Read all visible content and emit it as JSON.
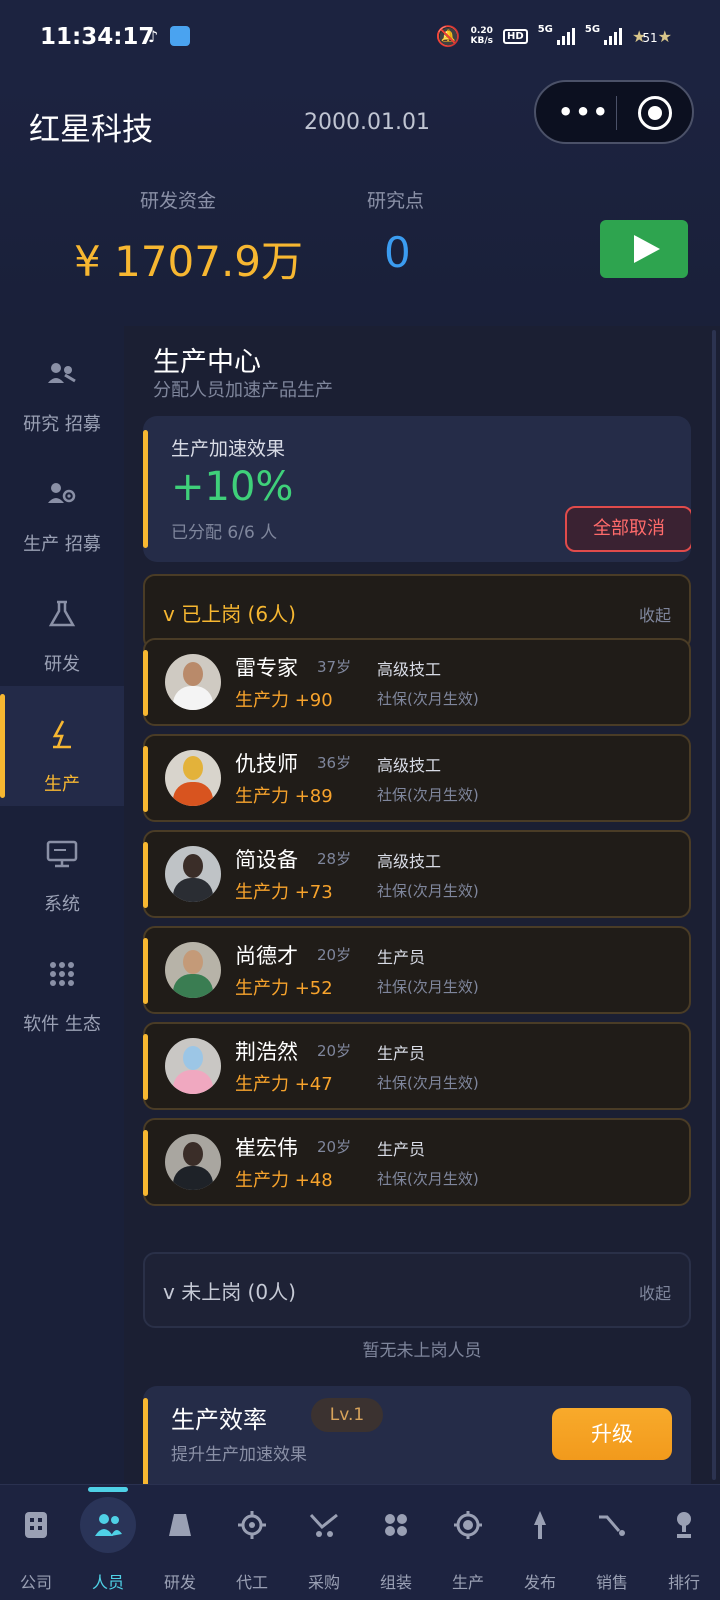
{
  "status_bar": {
    "time": "11:34:17",
    "net_speed_value": "0.20",
    "net_speed_unit": "KB/s",
    "hd_label": "HD",
    "net_1": "5G",
    "net_2": "5G",
    "battery_level": "51"
  },
  "header": {
    "company": "红星科技",
    "date": "2000.01.01",
    "fund_label": "研发资金",
    "fund_value": "¥ 1707.9万",
    "research_points_label": "研究点",
    "research_points_value": "0"
  },
  "sidebar": {
    "items": [
      {
        "label": "研究 招募",
        "icon": "research-recruit-icon"
      },
      {
        "label": "生产 招募",
        "icon": "production-recruit-icon"
      },
      {
        "label": "研发",
        "icon": "flask-icon"
      },
      {
        "label": "生产",
        "icon": "lightning-icon"
      },
      {
        "label": "系统",
        "icon": "monitor-icon"
      },
      {
        "label": "软件 生态",
        "icon": "grid-icon"
      }
    ],
    "active_index": 3
  },
  "main": {
    "title": "生产中心",
    "subtitle": "分配人员加速产品生产",
    "boost": {
      "title": "生产加速效果",
      "value": "+10%",
      "assigned": "已分配 6/6 人",
      "cancel_label": "全部取消"
    },
    "on_duty": {
      "title": "v 已上岗 (6人)",
      "collapse_label": "收起"
    },
    "workers": [
      {
        "name": "雷专家",
        "age": "37岁",
        "productivity": "生产力 +90",
        "title": "高级技工",
        "insurance": "社保(次月生效)"
      },
      {
        "name": "仇技师",
        "age": "36岁",
        "productivity": "生产力 +89",
        "title": "高级技工",
        "insurance": "社保(次月生效)"
      },
      {
        "name": "简设备",
        "age": "28岁",
        "productivity": "生产力 +73",
        "title": "高级技工",
        "insurance": "社保(次月生效)"
      },
      {
        "name": "尚德才",
        "age": "20岁",
        "productivity": "生产力 +52",
        "title": "生产员",
        "insurance": "社保(次月生效)"
      },
      {
        "name": "荆浩然",
        "age": "20岁",
        "productivity": "生产力 +47",
        "title": "生产员",
        "insurance": "社保(次月生效)"
      },
      {
        "name": "崔宏伟",
        "age": "20岁",
        "productivity": "生产力 +48",
        "title": "生产员",
        "insurance": "社保(次月生效)"
      }
    ],
    "off_duty": {
      "title": "v 未上岗 (0人)",
      "collapse_label": "收起",
      "empty_note": "暂无未上岗人员"
    },
    "efficiency": {
      "title": "生产效率",
      "level": "Lv.1",
      "subtitle": "提升生产加速效果",
      "upgrade_label": "升级"
    }
  },
  "bottom_nav": {
    "items": [
      {
        "label": "公司",
        "icon": "company-icon"
      },
      {
        "label": "人员",
        "icon": "people-icon"
      },
      {
        "label": "研发",
        "icon": "research-icon"
      },
      {
        "label": "代工",
        "icon": "gear-icon"
      },
      {
        "label": "采购",
        "icon": "purchase-icon"
      },
      {
        "label": "组装",
        "icon": "assembly-icon"
      },
      {
        "label": "生产",
        "icon": "production-icon"
      },
      {
        "label": "发布",
        "icon": "launch-icon"
      },
      {
        "label": "销售",
        "icon": "sales-icon"
      },
      {
        "label": "排行",
        "icon": "trophy-icon"
      }
    ],
    "active_index": 1
  },
  "colors": {
    "accent": "#f7b731",
    "boost_value": "#3fd07a",
    "research_points": "#3b9cf0",
    "play_button": "#2ea44f",
    "cancel": "#e04b4b",
    "nav_active": "#4fd1e6"
  }
}
